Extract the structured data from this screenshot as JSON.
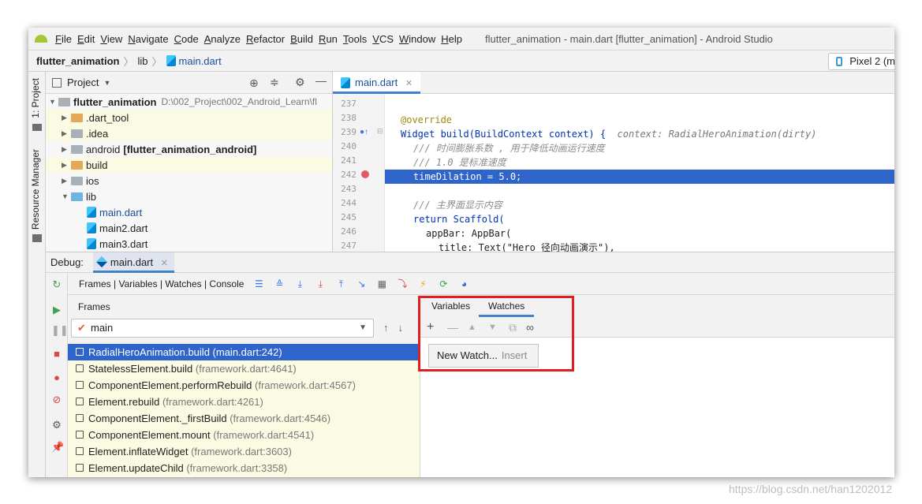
{
  "menu": [
    "File",
    "Edit",
    "View",
    "Navigate",
    "Code",
    "Analyze",
    "Refactor",
    "Build",
    "Run",
    "Tools",
    "VCS",
    "Window",
    "Help"
  ],
  "window_title": "flutter_animation - main.dart [flutter_animation] - Android Studio",
  "breadcrumb": {
    "project": "flutter_animation",
    "folder": "lib",
    "file": "main.dart"
  },
  "device": "Pixel 2 (m",
  "side_tabs": {
    "project": "1: Project",
    "resource_manager": "Resource Manager"
  },
  "project_panel": {
    "title": "Project",
    "root_name": "flutter_animation",
    "root_path": "D:\\002_Project\\002_Android_Learn\\fl",
    "items": [
      {
        "name": ".dart_tool",
        "suffix": ""
      },
      {
        "name": ".idea",
        "suffix": ""
      },
      {
        "name": "android",
        "suffix": "[flutter_animation_android]"
      },
      {
        "name": "build",
        "suffix": ""
      },
      {
        "name": "ios",
        "suffix": ""
      },
      {
        "name": "lib",
        "suffix": ""
      },
      {
        "name": "main.dart",
        "suffix": ""
      },
      {
        "name": "main2.dart",
        "suffix": ""
      },
      {
        "name": "main3.dart",
        "suffix": ""
      }
    ]
  },
  "editor": {
    "tab": "main.dart",
    "line_numbers": [
      "237",
      "238",
      "239",
      "240",
      "241",
      "242",
      "243",
      "244",
      "245",
      "246",
      "247"
    ],
    "lines": [
      "",
      "@override",
      "Widget build(BuildContext context) {",
      "/// 时间膨胀系数 , 用于降低动画运行速度",
      "/// 1.0 是标准速度",
      "timeDilation = 5.0;",
      "",
      "/// 主界面显示内容",
      "return Scaffold(",
      "appBar: AppBar(",
      "title: Text(\"Hero 径向动画演示\"),"
    ],
    "hint": "context: RadialHeroAnimation(dirty)"
  },
  "debug": {
    "label": "Debug:",
    "tab": "main.dart",
    "toolbar_label": "Frames | Variables | Watches | Console",
    "frames_header": "Frames",
    "thread": "main",
    "frames": [
      {
        "method": "RadialHeroAnimation.build",
        "source": "(main.dart:242)"
      },
      {
        "method": "StatelessElement.build",
        "source": "(framework.dart:4641)"
      },
      {
        "method": "ComponentElement.performRebuild",
        "source": "(framework.dart:4567)"
      },
      {
        "method": "Element.rebuild",
        "source": "(framework.dart:4261)"
      },
      {
        "method": "ComponentElement._firstBuild",
        "source": "(framework.dart:4546)"
      },
      {
        "method": "ComponentElement.mount",
        "source": "(framework.dart:4541)"
      },
      {
        "method": "Element.inflateWidget",
        "source": "(framework.dart:3603)"
      },
      {
        "method": "Element.updateChild",
        "source": "(framework.dart:3358)"
      }
    ],
    "variables_tab": "Variables",
    "watches_tab": "Watches",
    "new_watch": "New Watch...",
    "new_watch_shortcut": "Insert"
  },
  "watermark": "https://blog.csdn.net/han1202012",
  "colors": {
    "selection": "#2f65ca",
    "highlight_box": "#e01f1f",
    "accent": "#4083c9"
  }
}
